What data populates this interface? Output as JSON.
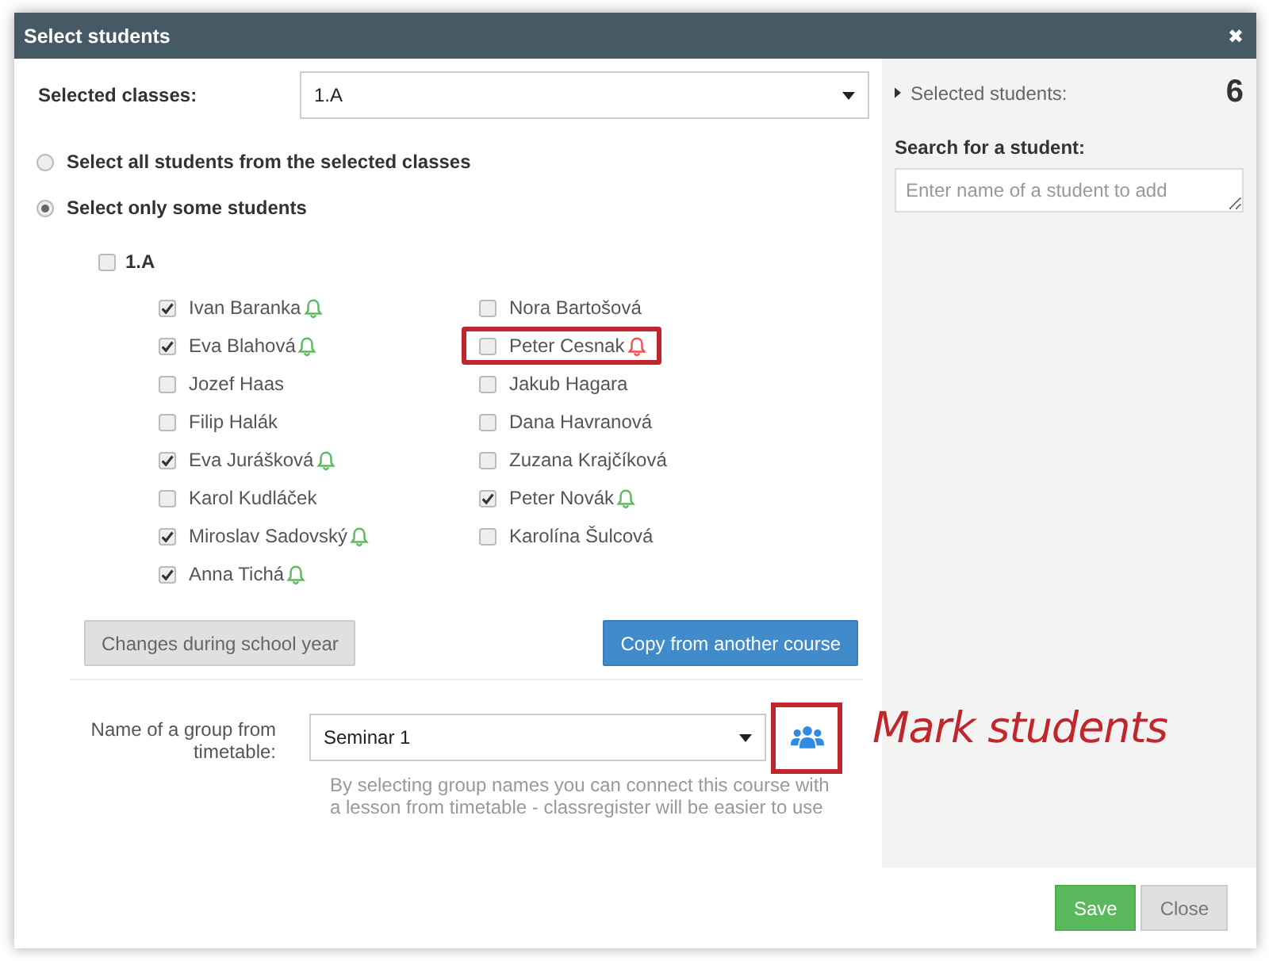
{
  "window": {
    "title": "Select students",
    "close": "✖"
  },
  "classes": {
    "label": "Selected classes:",
    "value": "1.A"
  },
  "mode_options": [
    {
      "label": "Select all students from the selected classes",
      "selected": false
    },
    {
      "label": "Select only some students",
      "selected": true
    }
  ],
  "class_group": {
    "label": "1.A",
    "checked": false,
    "columns": [
      [
        {
          "name": "Ivan Baranka",
          "checked": true,
          "bell": true,
          "color": "#5cb85c",
          "highlighted": false
        },
        {
          "name": "Eva Blahová",
          "checked": true,
          "bell": true,
          "color": "#5cb85c",
          "highlighted": false
        },
        {
          "name": "Jozef Haas",
          "checked": false,
          "bell": false,
          "highlighted": false
        },
        {
          "name": "Filip Halák",
          "checked": false,
          "bell": false,
          "highlighted": false
        },
        {
          "name": "Eva Jurášková",
          "checked": true,
          "bell": true,
          "color": "#5cb85c",
          "highlighted": false
        },
        {
          "name": "Karol Kudláček",
          "checked": false,
          "bell": false,
          "highlighted": false
        },
        {
          "name": "Miroslav Sadovský",
          "checked": true,
          "bell": true,
          "color": "#5cb85c",
          "highlighted": false
        },
        {
          "name": "Anna Tichá",
          "checked": true,
          "bell": true,
          "color": "#5cb85c",
          "highlighted": false
        }
      ],
      [
        {
          "name": "Nora Bartošová",
          "checked": false,
          "bell": false,
          "highlighted": false
        },
        {
          "name": "Peter Cesnak",
          "checked": false,
          "bell": true,
          "color": "#f05050",
          "highlighted": true
        },
        {
          "name": "Jakub Hagara",
          "checked": false,
          "bell": false,
          "highlighted": false
        },
        {
          "name": "Dana Havranová",
          "checked": false,
          "bell": false,
          "highlighted": false
        },
        {
          "name": "Zuzana Krajčíková",
          "checked": false,
          "bell": false,
          "highlighted": false
        },
        {
          "name": "Peter Novák",
          "checked": true,
          "bell": true,
          "color": "#5cb85c",
          "highlighted": false
        },
        {
          "name": "Karolína Šulcová",
          "checked": false,
          "bell": false,
          "highlighted": false
        }
      ]
    ]
  },
  "actions": [
    {
      "label": "Changes during school year",
      "kind": "secondary"
    },
    {
      "label": "Copy from another course",
      "kind": "primary"
    }
  ],
  "group": {
    "label": "Name of a group from timetable:",
    "value": "Seminar 1",
    "highlighted": true,
    "help": "By selecting group names you can connect this course with a lesson from timetable - classregister will be easier to use"
  },
  "annotation": {
    "text": "Mark students"
  },
  "sidebar": {
    "selected_label": "Selected students:",
    "selected_count": "6",
    "search_label": "Search for a student:",
    "search_placeholder": "Enter name of a student to add"
  },
  "footer": [
    {
      "label": "Save",
      "kind": "primary"
    },
    {
      "label": "Close",
      "kind": "secondary"
    }
  ]
}
